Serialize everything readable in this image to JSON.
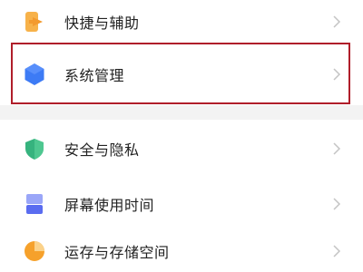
{
  "settings": {
    "items": [
      {
        "label": "快捷与辅助",
        "icon": "shortcut-icon",
        "color": "#f39a2e"
      },
      {
        "label": "系统管理",
        "icon": "hexagon-icon",
        "color": "#3d7bf5"
      },
      {
        "label": "安全与隐私",
        "icon": "shield-icon",
        "color": "#36b37e"
      },
      {
        "label": "屏幕使用时间",
        "icon": "screen-time-icon",
        "color": "#5a6cf0"
      },
      {
        "label": "运存与存储空间",
        "icon": "storage-pie-icon",
        "color": "#f6a12b"
      }
    ],
    "chevron_icon": "chevron-right-icon"
  }
}
